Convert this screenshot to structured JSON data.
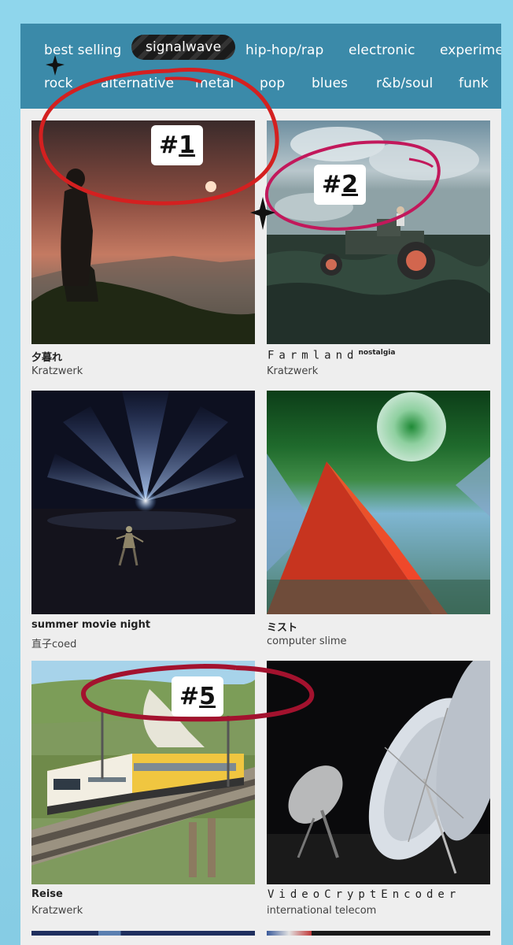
{
  "genres": {
    "row1": [
      "best selling",
      "signalwave",
      "hip-hop/rap",
      "electronic",
      "experimen"
    ],
    "row2": [
      "rock",
      "alternative",
      "metal",
      "pop",
      "blues",
      "r&b/soul",
      "funk"
    ],
    "active": "signalwave"
  },
  "albums": [
    {
      "title": "夕暮れ",
      "artist": "Kratzwerk",
      "badge_rank": "1"
    },
    {
      "title": "Farmland",
      "title_sup": "nostalgia",
      "artist": "Kratzwerk",
      "badge_rank": "2"
    },
    {
      "title": "summer movie night",
      "artist": "直子coed"
    },
    {
      "title": "ミスト",
      "artist": "computer slime"
    },
    {
      "title": "Reise",
      "artist": "Kratzwerk",
      "badge_rank": "5"
    },
    {
      "title": "VideoCryptEncoder",
      "artist": "international telecom"
    }
  ],
  "badge_prefix": "#",
  "colors": {
    "page_bg": "#8fd6ec",
    "genre_bar": "#3b8aa9",
    "active_pill": "#1c1c1c",
    "circle_red": "#d42020",
    "circle_magenta": "#c2185b",
    "circle_crimson": "#a3122e"
  }
}
